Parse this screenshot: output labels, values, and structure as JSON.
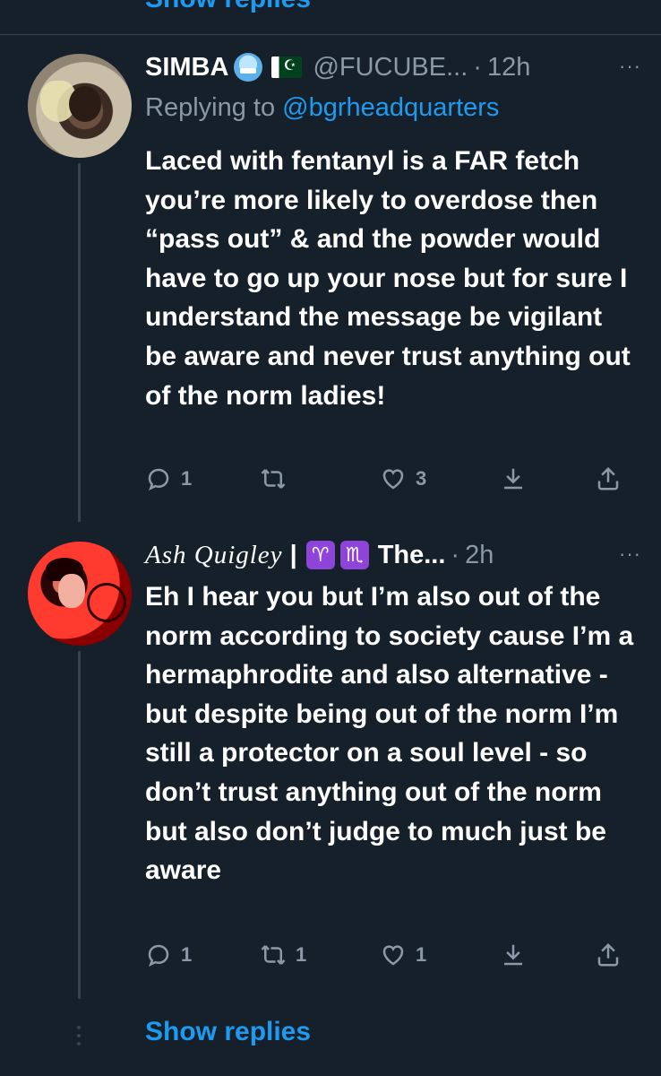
{
  "top_show_replies": "Show replies",
  "tweets": [
    {
      "name": "SIMBA",
      "handle": "@FUCUBE...",
      "separator": "·",
      "time": "12h",
      "more": "···",
      "replying_prefix": "Replying to",
      "replying_to": "@bgrheadquarters",
      "text": "Laced with fentanyl is a FAR fetch you’re more likely to overdose then “pass out” & and the powder would have to go up your nose but for sure I understand the message be vigilant be aware and never trust anything out of the norm ladies!",
      "reply_count": "1",
      "retweet_count": "",
      "like_count": "3"
    },
    {
      "name": "Ash Quigley",
      "name_bar": "|",
      "zodiac_1": "♈",
      "zodiac_2": "♏",
      "name_rest": "The...",
      "separator": "·",
      "time": "2h",
      "more": "···",
      "text": "Eh I hear you but I’m also out of the norm according to society cause I’m a hermaphrodite and also alternative - but despite being out of the norm I’m still a protector on a soul level - so don’t trust anything out of the norm but also don’t judge to much just be aware",
      "reply_count": "1",
      "retweet_count": "1",
      "like_count": "1"
    }
  ],
  "bottom_show_replies": "Show replies",
  "colors": {
    "background": "#15202b",
    "accent": "#1d9bf0",
    "muted": "#8b98a5",
    "divider": "#38444d"
  }
}
